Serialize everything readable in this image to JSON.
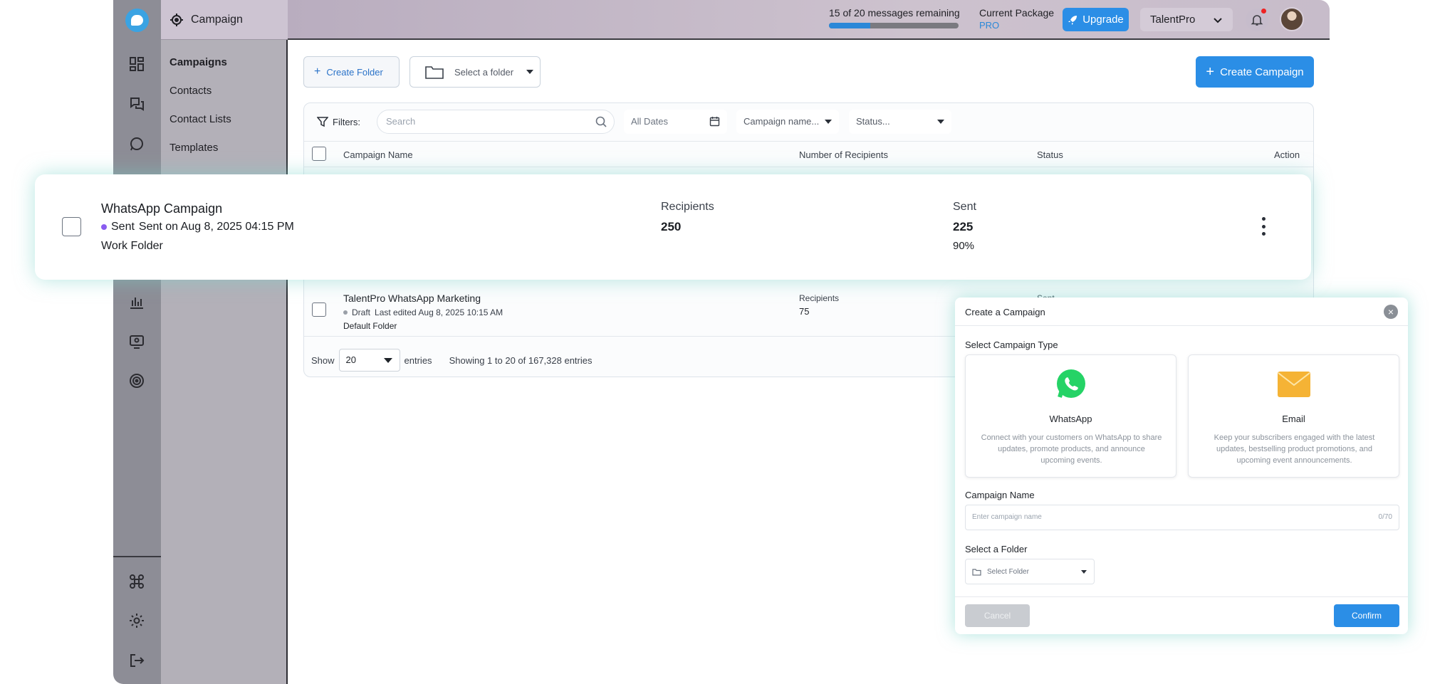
{
  "app": {
    "section_title": "Campaign"
  },
  "subnav": {
    "items": [
      {
        "label": "Campaigns"
      },
      {
        "label": "Contacts"
      },
      {
        "label": "Contact Lists"
      },
      {
        "label": "Templates"
      }
    ]
  },
  "topbar": {
    "quota_text": "15 of 20 messages remaining",
    "quota_fraction": 0.32,
    "package_label": "Current Package",
    "package_name": "PRO",
    "upgrade_label": "Upgrade",
    "account_name": "TalentPro"
  },
  "toolbar": {
    "create_folder_label": "Create Folder",
    "select_folder_label": "Select a folder",
    "create_campaign_label": "Create Campaign"
  },
  "filters": {
    "label": "Filters:",
    "search_placeholder": "Search",
    "dates_label": "All Dates",
    "campaign_name_label": "Campaign name...",
    "status_label": "Status..."
  },
  "table": {
    "columns": [
      "Campaign Name",
      "Number of Recipients",
      "Status",
      "Action"
    ],
    "rows": [
      {
        "name": "TalentPro WhatsApp Marketing",
        "status_word": "Draft",
        "status_meta": "Last edited Aug 8, 2025 10:15 AM",
        "folder": "Default Folder",
        "recipients_label": "Recipients",
        "recipients": "75",
        "status": "Sent"
      }
    ],
    "footer": {
      "show": "Show",
      "page_size": "20",
      "entries": "entries",
      "summary": "Showing 1 to 20 of 167,328 entries"
    }
  },
  "highlight_row": {
    "name": "WhatsApp Campaign",
    "status_word": "Sent",
    "status_meta": "Sent on Aug 8, 2025 04:15 PM",
    "folder": "Work Folder",
    "recipients_label": "Recipients",
    "recipients": "250",
    "sent_label": "Sent",
    "sent": "225",
    "sent_pct": "90%"
  },
  "modal": {
    "title": "Create a Campaign",
    "type_label": "Select Campaign Type",
    "types": [
      {
        "name": "WhatsApp",
        "desc": "Connect with your customers on WhatsApp to share updates, promote products, and announce upcoming events."
      },
      {
        "name": "Email",
        "desc": "Keep your subscribers engaged with the latest updates, bestselling product promotions, and upcoming event announcements."
      }
    ],
    "name_label": "Campaign Name",
    "name_placeholder": "Enter campaign name",
    "name_counter": "0/70",
    "folder_label": "Select a Folder",
    "folder_placeholder": "Select Folder",
    "cancel": "Cancel",
    "confirm": "Confirm"
  },
  "colors": {
    "accent": "#2b8ee6",
    "sent_dot": "#8a5cf0",
    "whatsapp": "#25d366",
    "email": "#f5b335"
  }
}
